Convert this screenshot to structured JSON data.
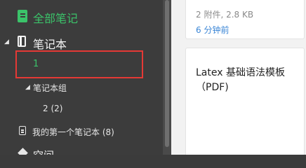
{
  "sidebar": {
    "all_notes_label": "全部笔记",
    "notebooks_label": "笔记本",
    "selected_notebook_label": "1",
    "group_label": "笔记本组",
    "group_child_label": "2  (2)",
    "first_notebook_label": "我的第一个笔记本  (8)",
    "space_label": "空间"
  },
  "notes": [
    {
      "meta": "2 附件, 2.8 KB",
      "time": "6 分钟前"
    },
    {
      "title": "Latex 基础语法模板（PDF)"
    }
  ],
  "colors": {
    "accent": "#3bc36a",
    "link": "#3b86d6",
    "selection_border": "#e53935",
    "sidebar_bg": "#3c3c3c"
  }
}
